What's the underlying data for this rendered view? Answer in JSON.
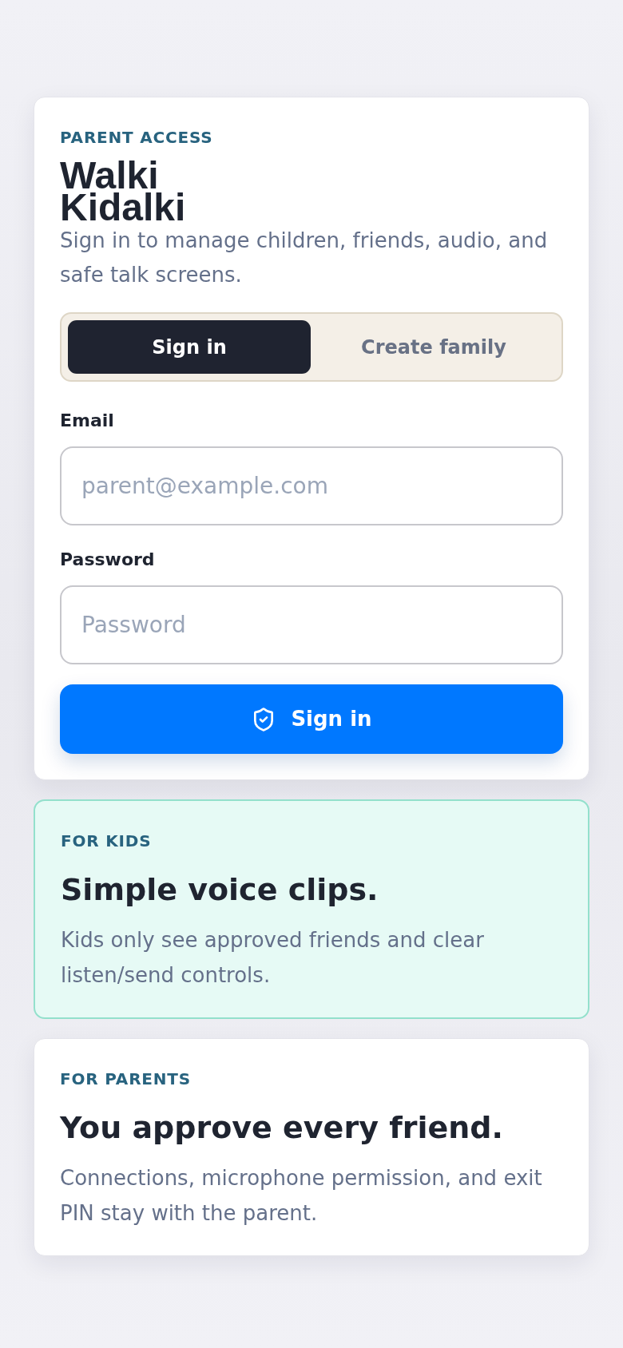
{
  "login_card": {
    "eyebrow": "PARENT ACCESS",
    "title": "Walki Kidalki",
    "subtitle": "Sign in to manage children, friends, audio, and safe talk screens.",
    "tabs": [
      {
        "label": "Sign in",
        "selected": true
      },
      {
        "label": "Create family",
        "selected": false
      }
    ],
    "fields": [
      {
        "label": "Email",
        "placeholder": "parent@example.com"
      },
      {
        "label": "Password",
        "placeholder": "Password"
      }
    ],
    "submit": {
      "label": "Sign in"
    }
  },
  "info_cards": [
    {
      "kind": "kids",
      "eyebrow": "FOR KIDS",
      "title": "Simple voice clips.",
      "body": "Kids only see approved friends and clear listen/send controls."
    },
    {
      "kind": "parents",
      "eyebrow": "FOR PARENTS",
      "title": "You approve every friend.",
      "body": "Connections, microphone permission, and exit PIN stay with the parent."
    }
  ]
}
